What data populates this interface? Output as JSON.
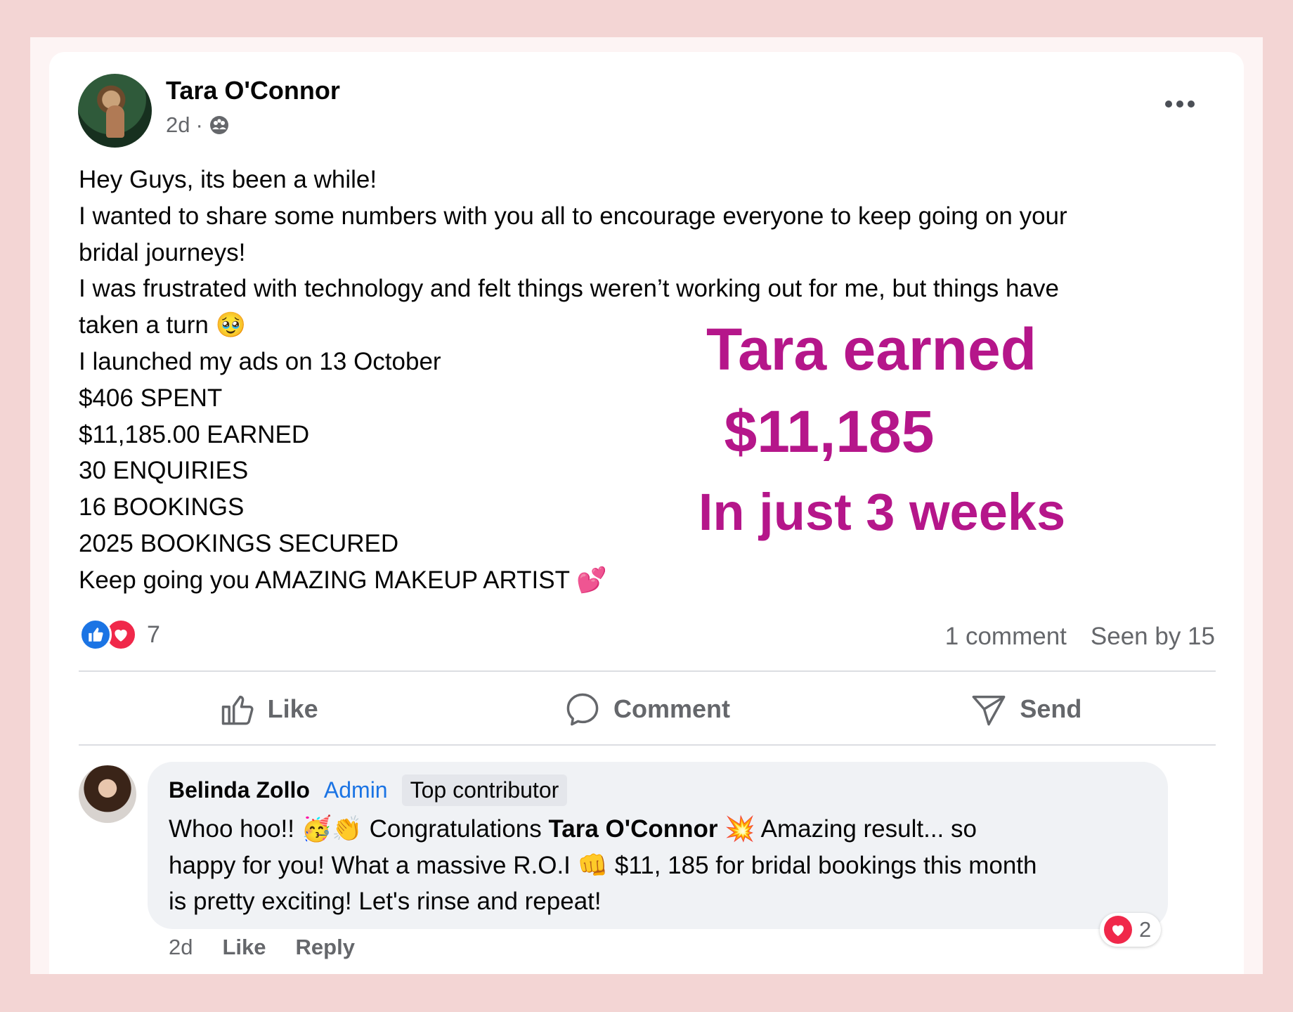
{
  "post": {
    "author": "Tara O'Connor",
    "time": "2d",
    "separator": "·",
    "icons": {
      "audience": "group-icon",
      "more": "more-options-icon"
    },
    "body_lines": [
      "Hey Guys, its been a while!",
      "I wanted to share some numbers with you all to encourage everyone to keep going on your",
      "bridal journeys!",
      "I was frustrated with technology and felt things weren’t working out for me, but things have",
      "taken a turn 🥹",
      "I launched my ads on 13 October",
      "$406 SPENT",
      "$11,185.00 EARNED",
      "30 ENQUIRIES",
      "16 BOOKINGS",
      "2025 BOOKINGS SECURED",
      "Keep going you AMAZING MAKEUP ARTIST 💕"
    ],
    "reaction_count": "7",
    "comment_count": "1 comment",
    "seen_by": "Seen by 15"
  },
  "overlay": {
    "line1": "Tara earned",
    "line2": "$11,185",
    "line3": "In just 3 weeks",
    "color": "#b5168a"
  },
  "actions": {
    "like": "Like",
    "comment": "Comment",
    "send": "Send"
  },
  "comment": {
    "author": "Belinda Zollo",
    "badge_admin": "Admin",
    "badge_top": "Top contributor",
    "line1_pre": "Whoo hoo!! 🥳👏 Congratulations ",
    "line1_mention": "Tara O'Connor",
    "line1_post": " 💥 Amazing result... so",
    "line2": "happy for you! What a massive R.O.I 👊 $11, 185 for bridal bookings this month",
    "line3": "is pretty exciting! Let's rinse and repeat!",
    "time": "2d",
    "like": "Like",
    "reply": "Reply",
    "reaction_count": "2"
  },
  "colors": {
    "background": "#f3d5d4",
    "like_blue": "#1b74e4",
    "love_red": "#f0284a"
  }
}
